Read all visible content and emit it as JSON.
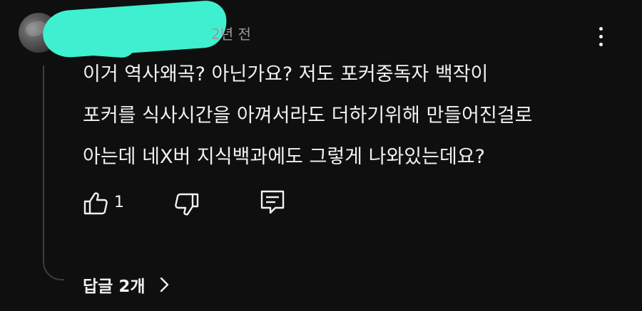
{
  "comment": {
    "author": "",
    "timestamp": "2년 전",
    "lines": [
      "이거 역사왜곡? 아닌가요? 저도 포커중독자 백작이",
      "포커를 식사시간을 아껴서라도 더하기위해 만들어진걸로",
      "아는데 네X버 지식백과에도 그렇게 나와있는데요?"
    ]
  },
  "actions": {
    "like_count": "1",
    "like_icon": "thumbs-up-icon",
    "dislike_icon": "thumbs-down-icon",
    "reply_icon": "reply-comment-icon"
  },
  "replies": {
    "label": "답글 2개",
    "icon": "chevron-right-icon"
  },
  "menu": {
    "icon": "more-vertical-icon"
  },
  "colors": {
    "background": "#0f0f0f",
    "text": "#f1f1f1",
    "meta": "#9a9a9a",
    "redaction": "#3ef0cf"
  }
}
